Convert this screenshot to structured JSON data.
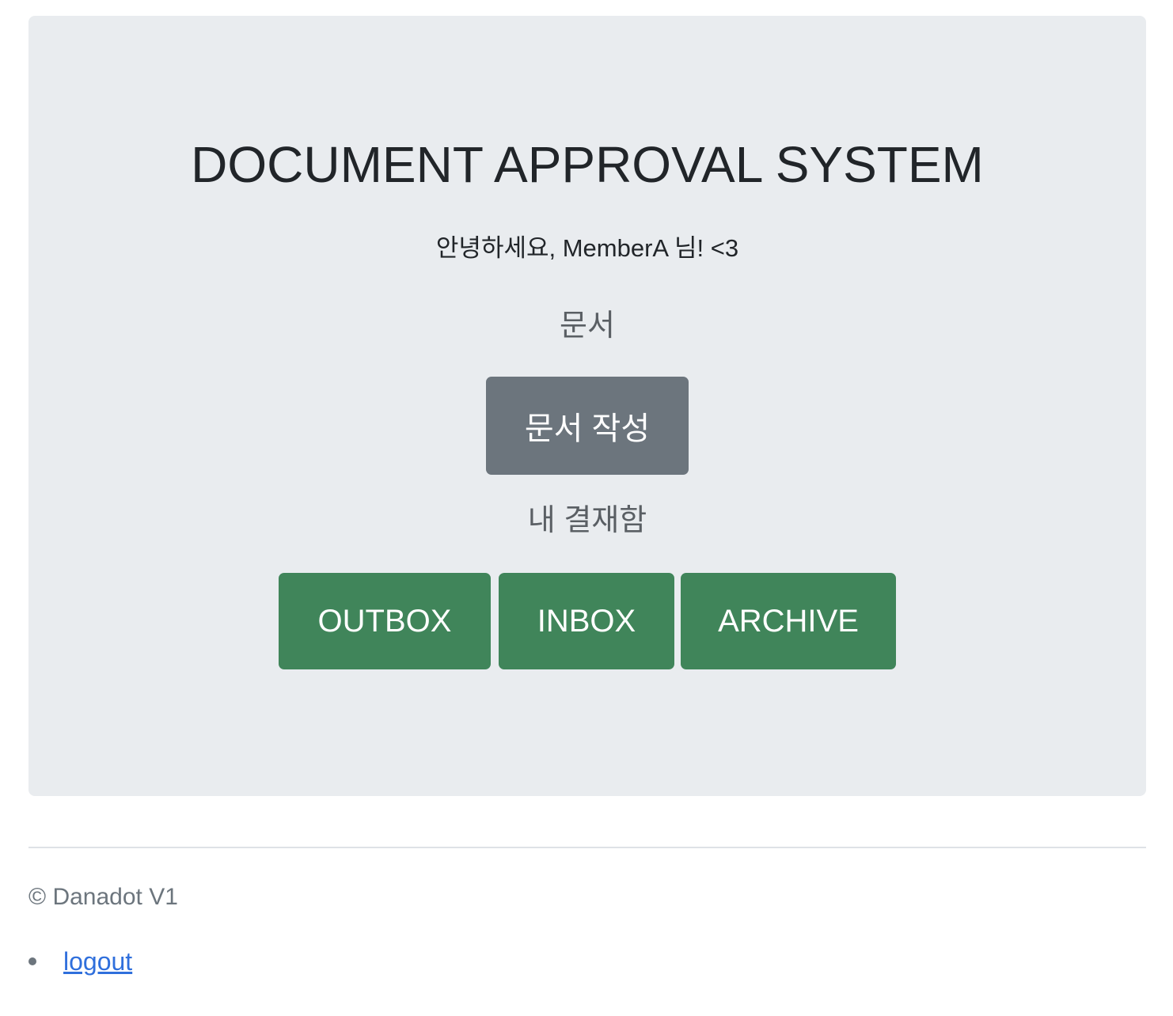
{
  "hero": {
    "title": "DOCUMENT APPROVAL SYSTEM",
    "greeting": "안녕하세요, MemberA 님! <3",
    "documents_label": "문서",
    "write_button": "문서 작성",
    "approval_box_label": "내 결재함",
    "box_buttons": [
      "OUTBOX",
      "INBOX",
      "ARCHIVE"
    ]
  },
  "footer": {
    "copyright": "© Danadot V1",
    "links": [
      "logout"
    ]
  },
  "colors": {
    "jumbotron_bg": "#e9ecef",
    "secondary_button": "#6c757d",
    "success_button": "#40855a",
    "link": "#2f6fdc"
  }
}
